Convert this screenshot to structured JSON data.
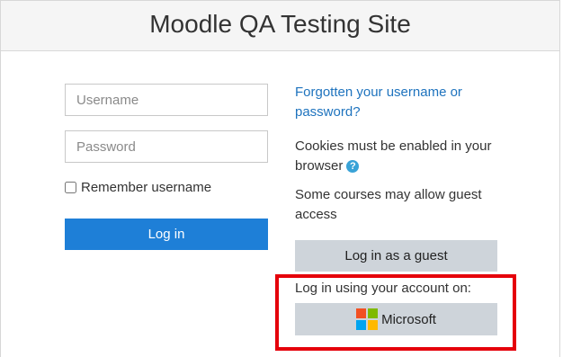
{
  "site": {
    "title": "Moodle QA Testing Site"
  },
  "login_form": {
    "username_placeholder": "Username",
    "password_placeholder": "Password",
    "remember_label": "Remember username",
    "remember_checked": false,
    "login_button": "Log in"
  },
  "info": {
    "forgot_link": "Forgotten your username or password?",
    "cookies_text": "Cookies must be enabled in your browser",
    "help_icon": "question-circle-icon",
    "guest_note": "Some courses may allow guest access",
    "guest_button": "Log in as a guest"
  },
  "oauth": {
    "label": "Log in using your account on:",
    "provider_button": "Microsoft",
    "provider_icon": "microsoft-logo-icon"
  },
  "colors": {
    "primary": "#1e7fd7",
    "link": "#1e73be",
    "secondary_button": "#ced4da",
    "highlight": "#e5000a",
    "help_icon": "#3aa3d7"
  }
}
